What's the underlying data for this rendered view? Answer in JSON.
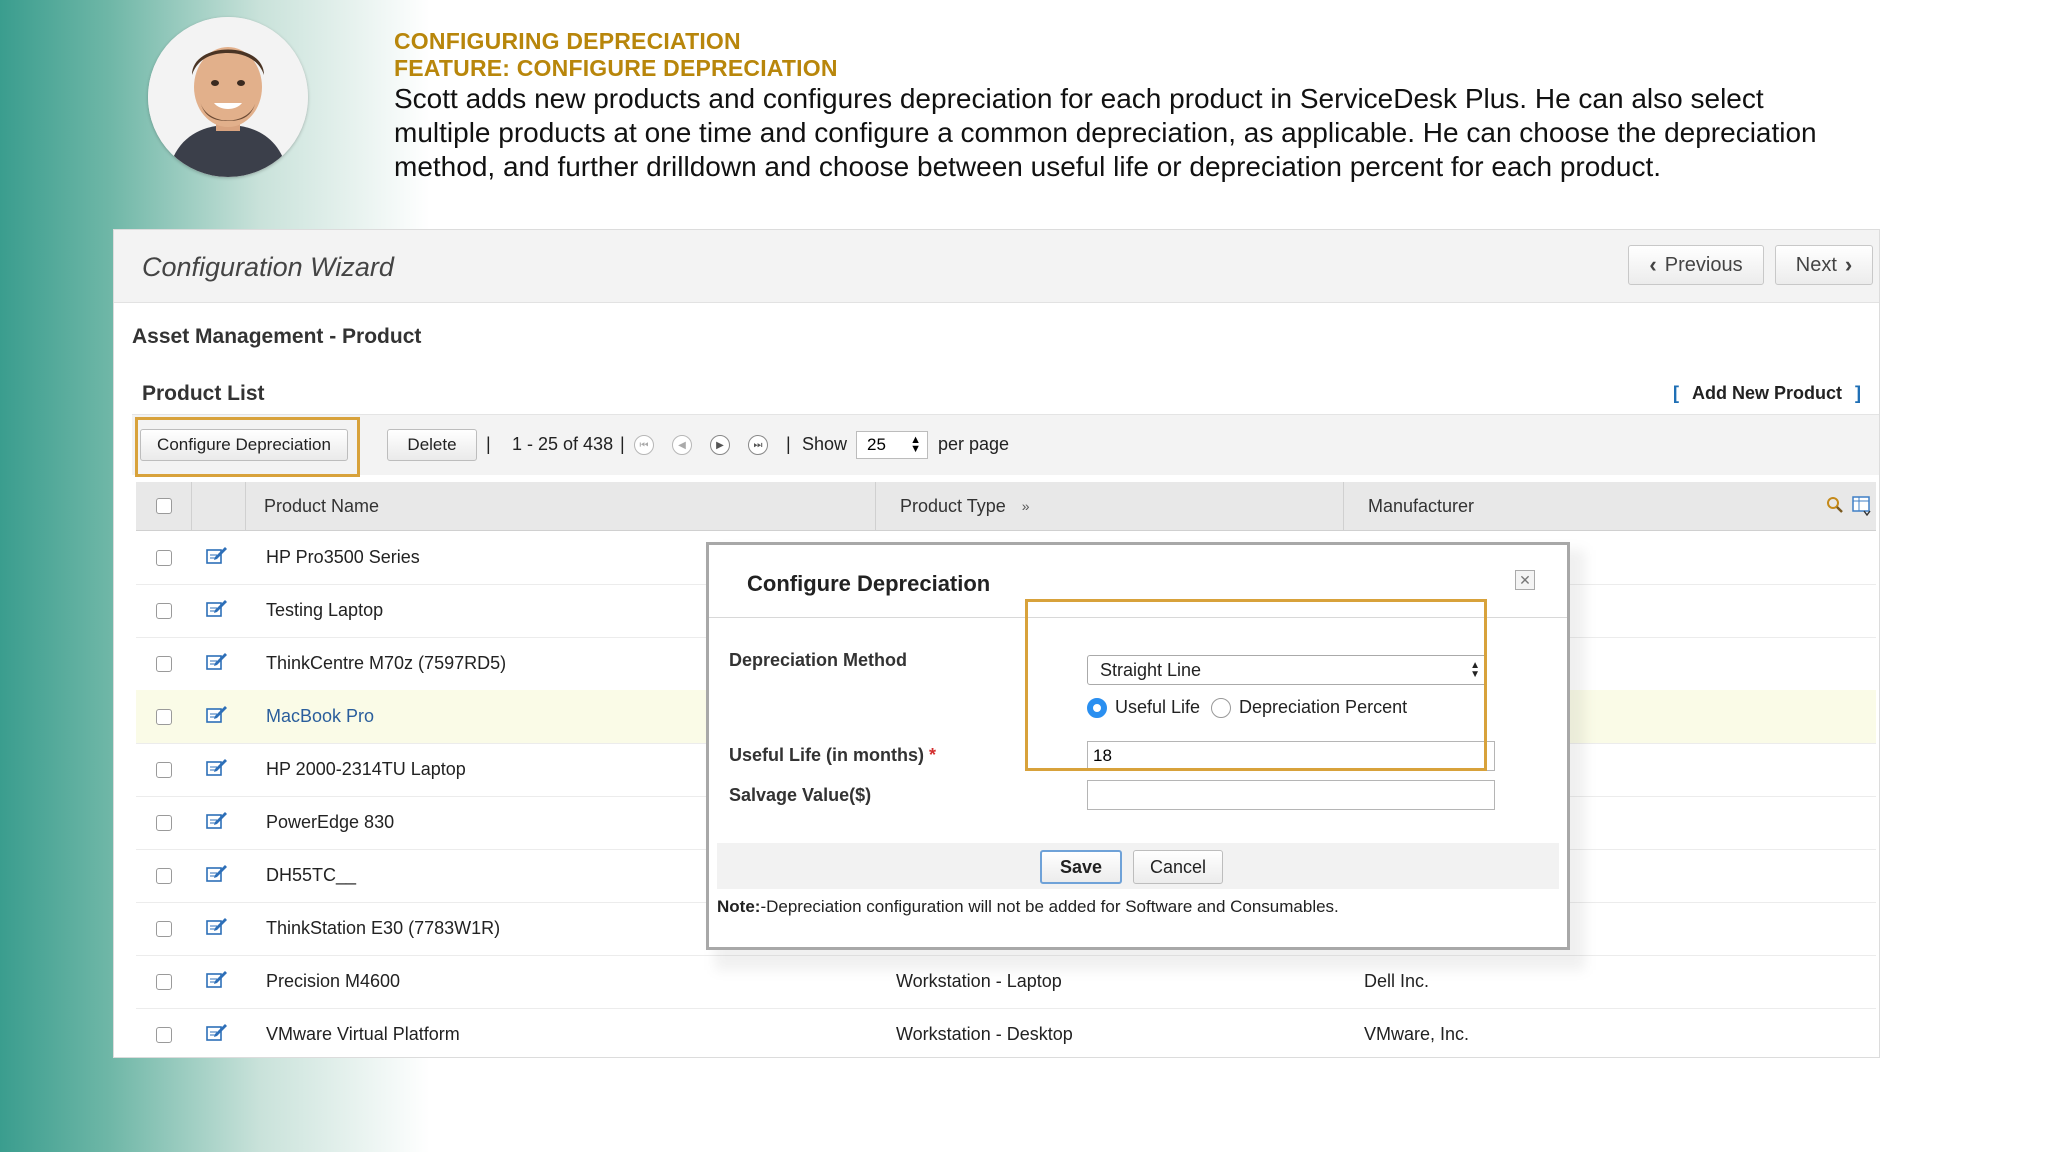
{
  "header": {
    "title": "CONFIGURING DEPRECIATION",
    "feature": "FEATURE: CONFIGURE DEPRECIATION",
    "description": "Scott adds new products and configures depreciation for each product in ServiceDesk Plus. He can also select multiple products at one time and configure a common depreciation, as applicable. He can choose the depreciation method, and further drilldown and choose between useful life or depreciation percent for each product."
  },
  "colors": {
    "accent_gold": "#b8860b",
    "highlight_orange": "#d8a23b",
    "link_blue": "#1f6fb5",
    "radio_blue": "#2a8ff0"
  },
  "wizard": {
    "title": "Configuration Wizard",
    "previous_label": "Previous",
    "next_label": "Next"
  },
  "page": {
    "section_title": "Asset Management - Product",
    "list_title": "Product List",
    "add_new_label": "Add New Product"
  },
  "toolbar": {
    "configure_label": "Configure Depreciation",
    "delete_label": "Delete",
    "range_text": "1 - 25 of 438",
    "show_label": "Show",
    "per_page_value": "25",
    "per_page_label": "per page"
  },
  "table": {
    "headers": {
      "name": "Product Name",
      "type": "Product Type",
      "manufacturer": "Manufacturer"
    },
    "rows": [
      {
        "name": "HP Pro3500 Series",
        "type": "",
        "manufacturer": ""
      },
      {
        "name": "Testing Laptop",
        "type": "",
        "manufacturer": ""
      },
      {
        "name": "ThinkCentre M70z (7597RD5)",
        "type": "",
        "manufacturer": ""
      },
      {
        "name": "MacBook Pro",
        "type": "",
        "manufacturer": ""
      },
      {
        "name": "HP 2000-2314TU Laptop",
        "type": "",
        "manufacturer": ""
      },
      {
        "name": "PowerEdge 830",
        "type": "",
        "manufacturer": ""
      },
      {
        "name": "DH55TC__",
        "type": "",
        "manufacturer": ""
      },
      {
        "name": "ThinkStation E30 (7783W1R)",
        "type": "",
        "manufacturer": ""
      },
      {
        "name": "Precision M4600",
        "type": "Workstation - Laptop",
        "manufacturer": "Dell Inc."
      },
      {
        "name": "VMware Virtual Platform",
        "type": "Workstation - Desktop",
        "manufacturer": "VMware, Inc."
      }
    ]
  },
  "dialog": {
    "title": "Configure Depreciation",
    "method_label": "Depreciation Method",
    "method_value": "Straight Line",
    "radio_useful_life": "Useful Life",
    "radio_percent": "Depreciation Percent",
    "useful_life_label": "Useful Life (in months)",
    "required_mark": "*",
    "useful_life_value": "18",
    "salvage_label": "Salvage Value($)",
    "salvage_value": "",
    "save_label": "Save",
    "cancel_label": "Cancel",
    "note_prefix": "Note:",
    "note_text": "-Depreciation configuration will not be added for Software and Consumables."
  }
}
